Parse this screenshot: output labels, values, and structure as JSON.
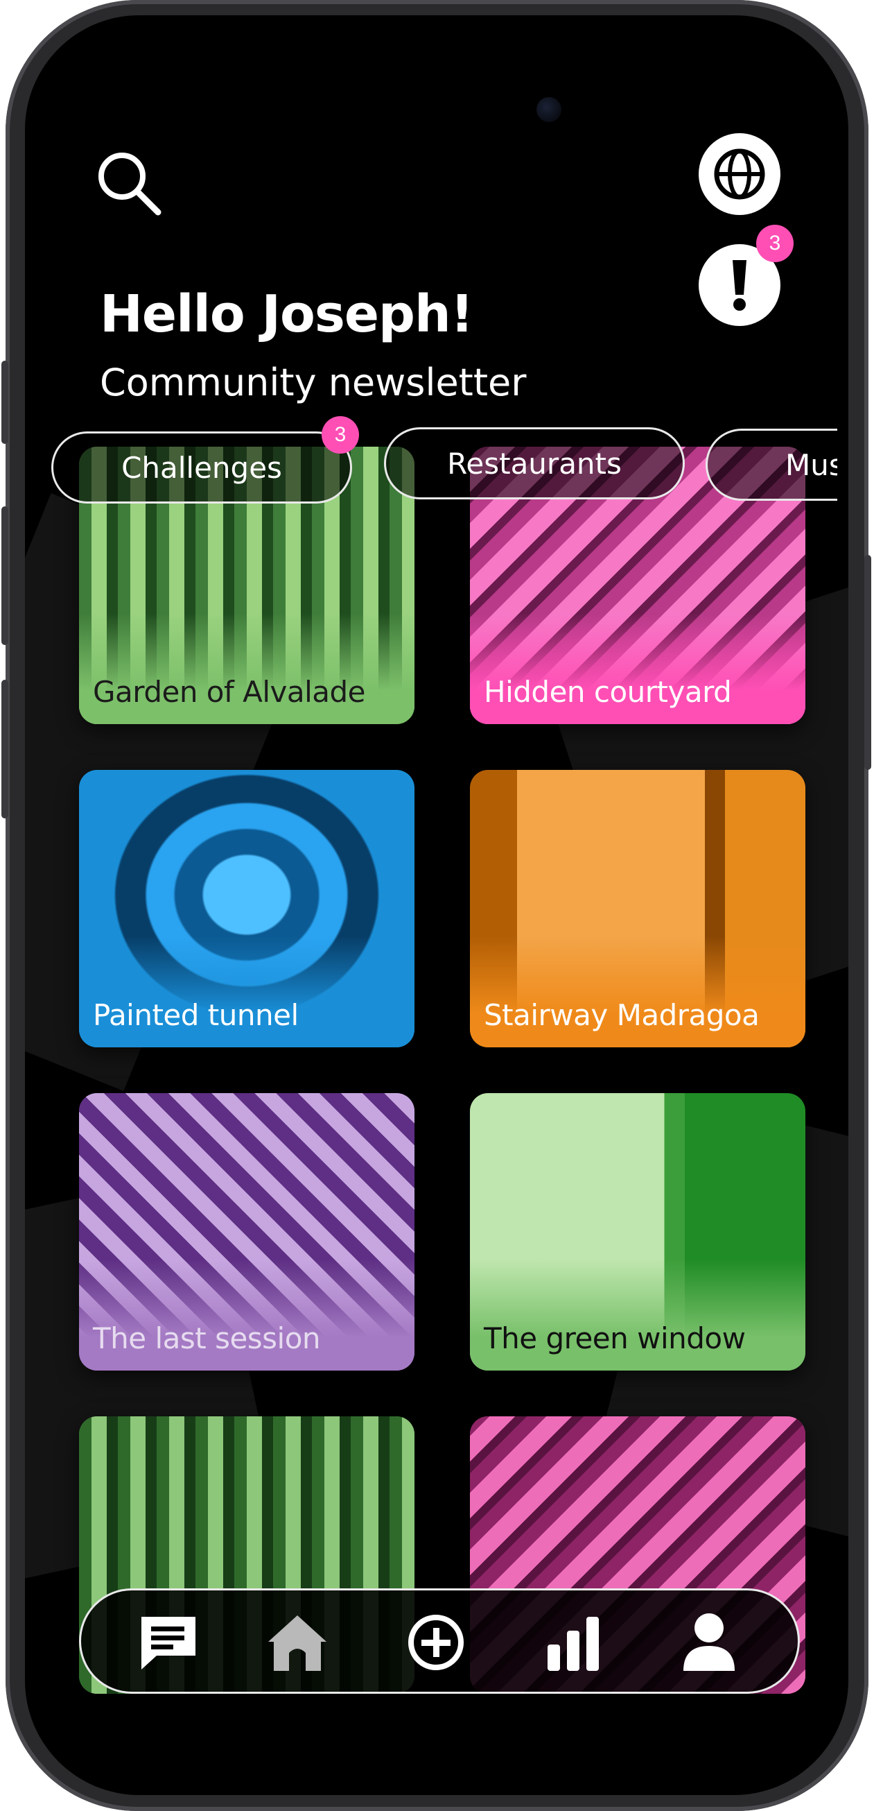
{
  "header": {
    "greeting": "Hello Joseph!",
    "subtitle": "Community newsletter",
    "notification_badge": "3"
  },
  "categories": [
    {
      "label": "Challenges",
      "badge": "3"
    },
    {
      "label": "Restaurants"
    },
    {
      "label": "Mus"
    }
  ],
  "cards": [
    {
      "title": "Garden of Alvalade",
      "color": "#7cc06a"
    },
    {
      "title": "Hidden courtyard",
      "color": "#ff4fb5"
    },
    {
      "title": "Painted tunnel",
      "color": "#1a8fd8"
    },
    {
      "title": "Stairway Madragoa",
      "color": "#ef8a1a"
    },
    {
      "title": "The last session",
      "color": "#a47ac4"
    },
    {
      "title": "The green window",
      "color": "#78c06a"
    },
    {
      "title": "",
      "color": "#59b04f"
    },
    {
      "title": "",
      "color": "#e04a9c"
    }
  ],
  "nav": [
    {
      "name": "chat-icon"
    },
    {
      "name": "home-icon"
    },
    {
      "name": "add-icon"
    },
    {
      "name": "stats-icon"
    },
    {
      "name": "profile-icon"
    }
  ]
}
